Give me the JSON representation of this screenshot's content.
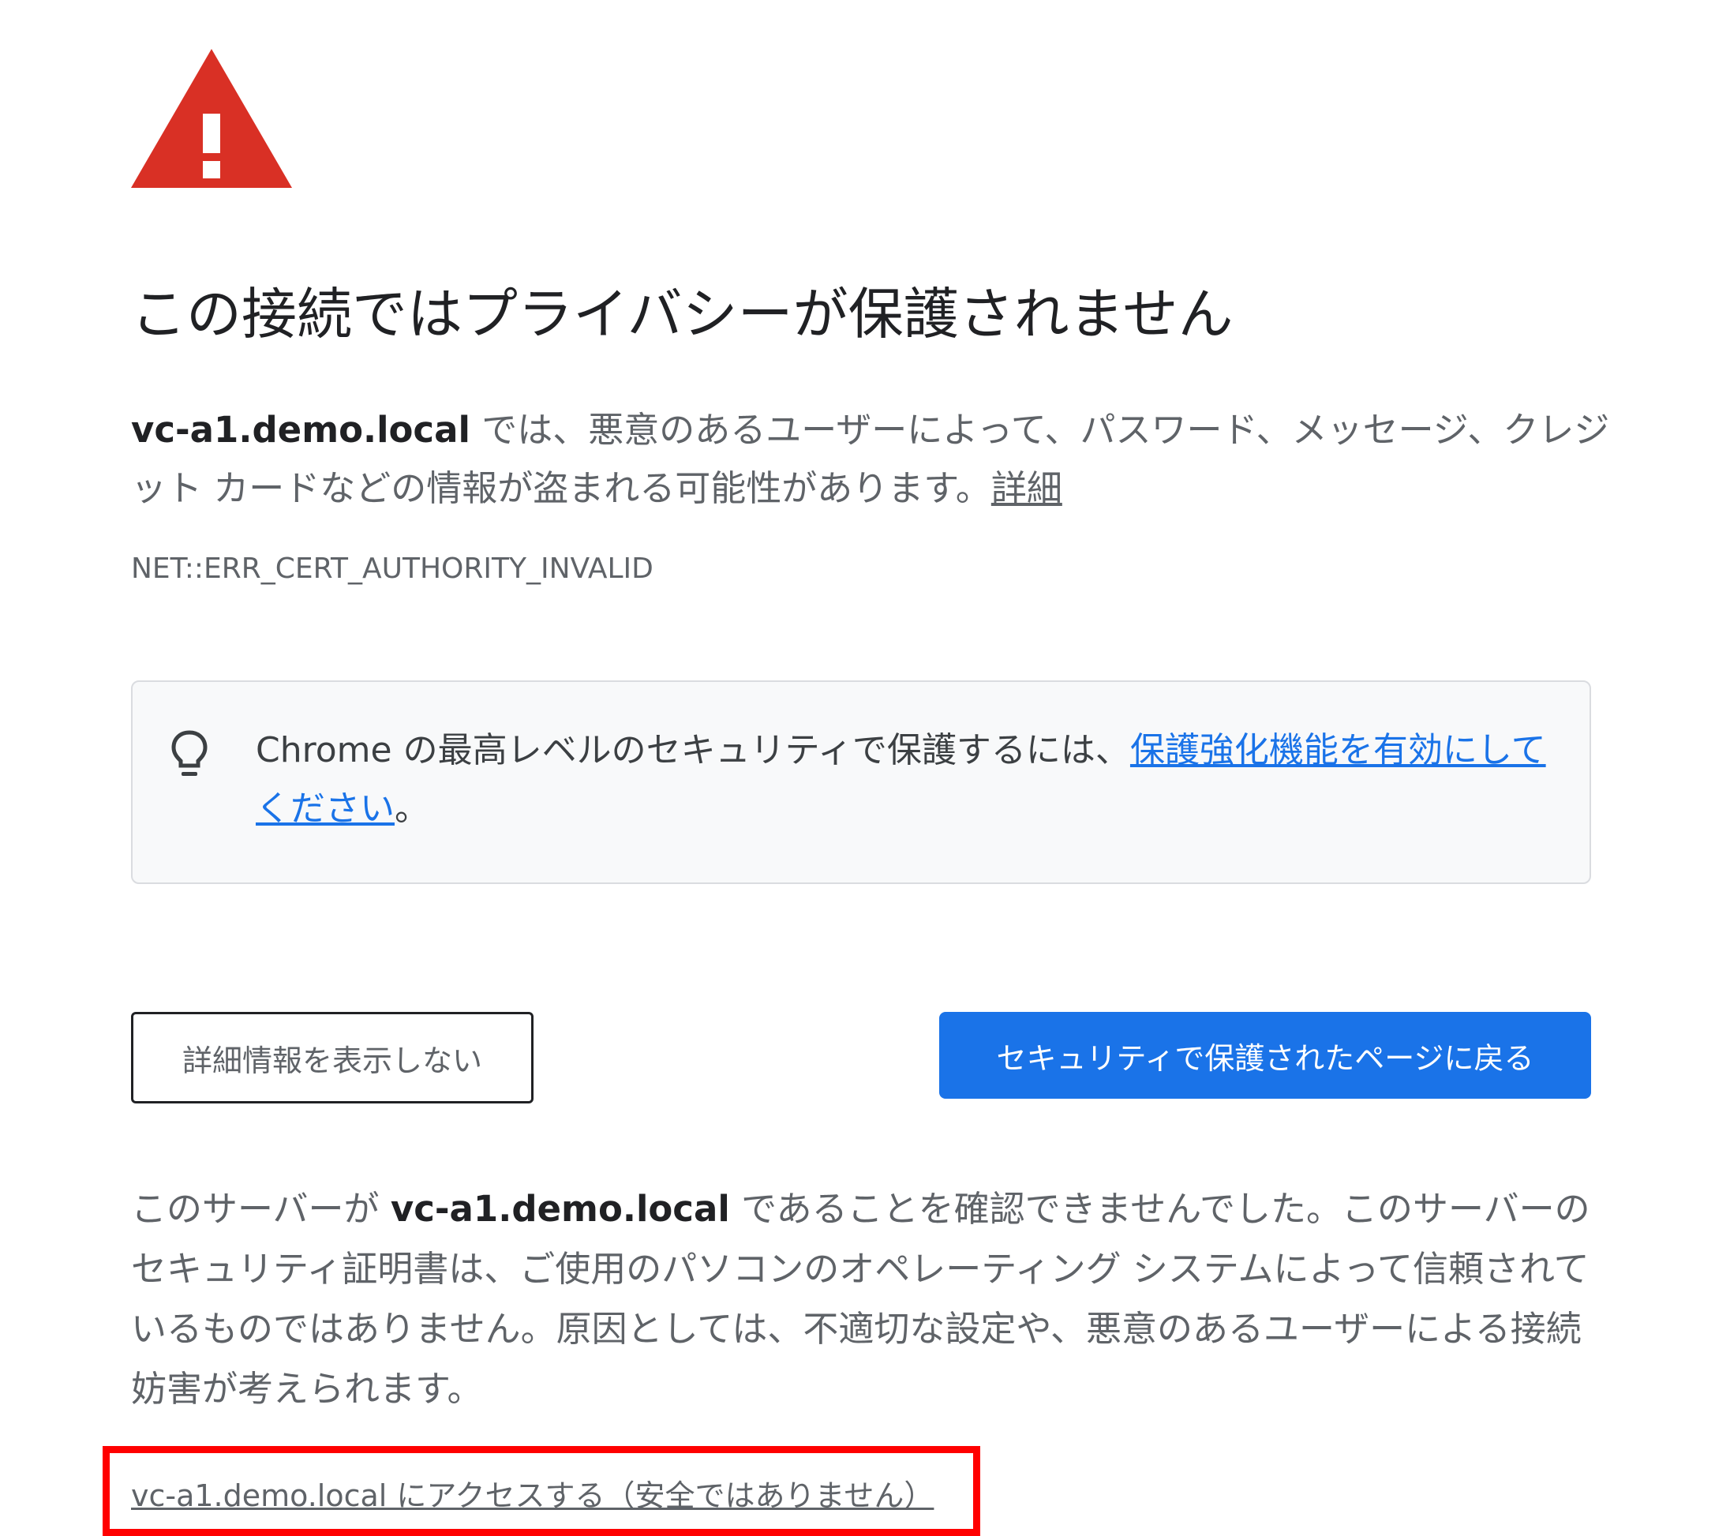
{
  "title": "この接続ではプライバシーが保護されません",
  "description": {
    "host": "vc-a1.demo.local",
    "text": " では、悪意のあるユーザーによって、パスワード、メッセージ、クレジット カードなどの情報が盗まれる可能性があります。",
    "learn_more": "詳細"
  },
  "error_code": "NET::ERR_CERT_AUTHORITY_INVALID",
  "enhanced_protection": {
    "text": "Chrome の最高レベルのセキュリティで保護するには、",
    "link": "保護強化機能を有効にしてください",
    "suffix": "。"
  },
  "buttons": {
    "details": "詳細情報を表示しない",
    "back": "セキュリティで保護されたページに戻る"
  },
  "explanation": {
    "before": "このサーバーが ",
    "host": "vc-a1.demo.local",
    "after": " であることを確認できませんでした。このサーバーのセキュリティ証明書は、ご使用のパソコンのオペレーティング システムによって信頼されているものではありません。原因としては、不適切な設定や、悪意のあるユーザーによる接続妨害が考えられます。"
  },
  "proceed_link": "vc-a1.demo.local にアクセスする（安全ではありません）",
  "icons": {
    "warning": "warning-triangle-icon",
    "lightbulb": "lightbulb-icon"
  },
  "colors": {
    "warning_red": "#d93025",
    "primary_blue": "#1a73e8",
    "annotation_red": "#ff0000"
  }
}
